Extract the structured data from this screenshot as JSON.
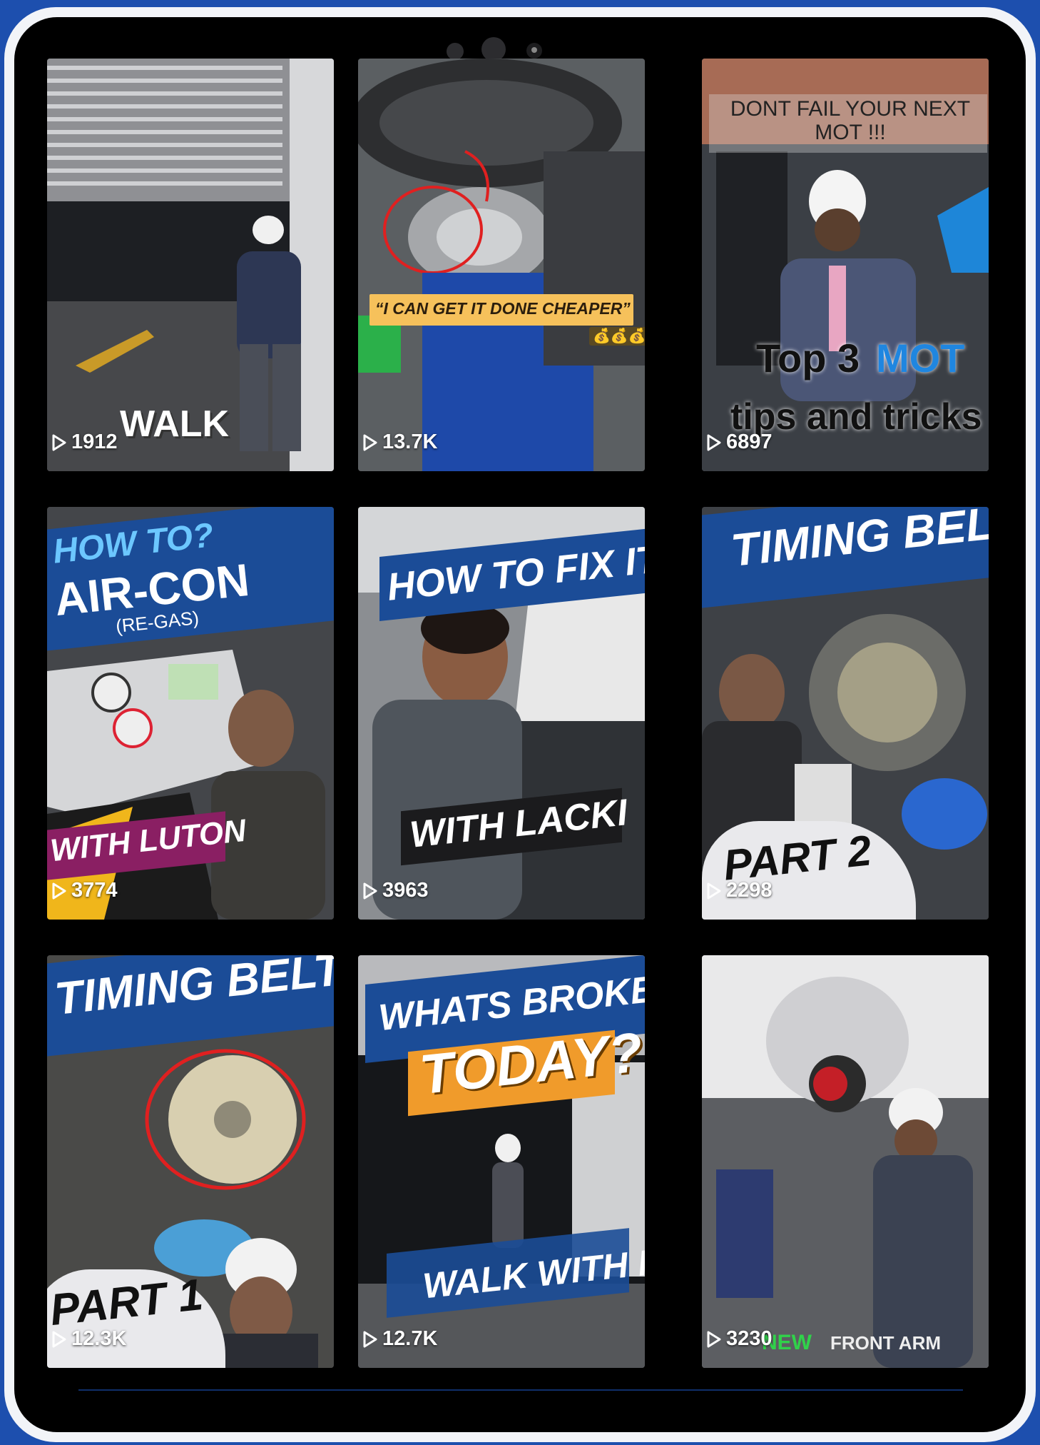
{
  "videos": [
    {
      "views": "1912",
      "caption": "WALK"
    },
    {
      "views": "13.7K",
      "caption": "“I CAN GET IT DONE CHEAPER”",
      "emoji": "💰💰💰"
    },
    {
      "views": "6897",
      "caption_top": "DONT FAIL YOUR NEXT MOT !!!",
      "caption_a": "Top 3",
      "caption_b": "MOT",
      "caption_c": "tips and tricks"
    },
    {
      "views": "3774",
      "caption_top": "HOW TO?",
      "caption_main": "AIR-CON",
      "caption_sub": "(RE-GAS)",
      "caption_bottom": "WITH LUTON"
    },
    {
      "views": "3963",
      "caption_top": "HOW TO FIX IT",
      "caption_bottom": "WITH LACKI"
    },
    {
      "views": "2298",
      "caption_top": "TIMING BELT",
      "caption_bottom": "PART 2"
    },
    {
      "views": "12.3K",
      "caption_top": "TIMING BELT",
      "caption_bottom": "PART 1"
    },
    {
      "views": "12.7K",
      "caption_top": "WHATS BROKEN",
      "caption_main": "TODAY?",
      "caption_bottom": "WALK WITH ME!"
    },
    {
      "views": "3230",
      "caption_a": "NEW",
      "caption_b": "FRONT ARM"
    }
  ],
  "colors": {
    "frame": "#1d4fae",
    "banner_blue": "#1b4c97",
    "accent_yellow": "#f6c15b",
    "accent_magenta": "#8a1f63",
    "accent_green": "#30d24a"
  }
}
